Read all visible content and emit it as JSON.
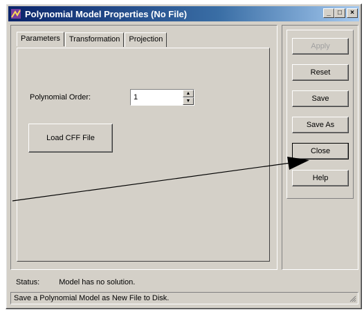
{
  "window": {
    "title": "Polynomial Model Properties (No File)",
    "title_buttons": [
      "_",
      "□",
      "×"
    ]
  },
  "tabs": [
    {
      "label": "Parameters",
      "active": true
    },
    {
      "label": "Transformation",
      "active": false
    },
    {
      "label": "Projection",
      "active": false
    }
  ],
  "parameters": {
    "order_label": "Polynomial Order:",
    "order_value": "1",
    "load_button": "Load CFF File"
  },
  "side_buttons": {
    "apply": "Apply",
    "reset": "Reset",
    "save": "Save",
    "save_as": "Save As",
    "close": "Close",
    "help": "Help"
  },
  "status": {
    "label": "Status:",
    "text": "Model has no solution."
  },
  "statusbar": {
    "text": "Save a Polynomial Model as New File to Disk."
  },
  "colors": {
    "title_gradient_start": "#0a246a",
    "title_gradient_end": "#a6caf0",
    "face": "#d4d0c8"
  }
}
